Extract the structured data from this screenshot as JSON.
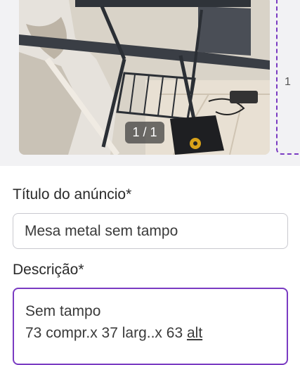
{
  "gallery": {
    "counter": "1 / 1",
    "overflow_glyph": "1"
  },
  "form": {
    "title_label": "Título do anúncio*",
    "title_value": "Mesa metal sem tampo",
    "description_label": "Descrição*",
    "description_line1": "Sem tampo",
    "description_line2_prefix": "73 compr.x 37 larg..x 63 ",
    "description_line2_underlined": "alt"
  },
  "colors": {
    "focus_border": "#7a3bc2",
    "field_border": "#c9c9cf"
  }
}
